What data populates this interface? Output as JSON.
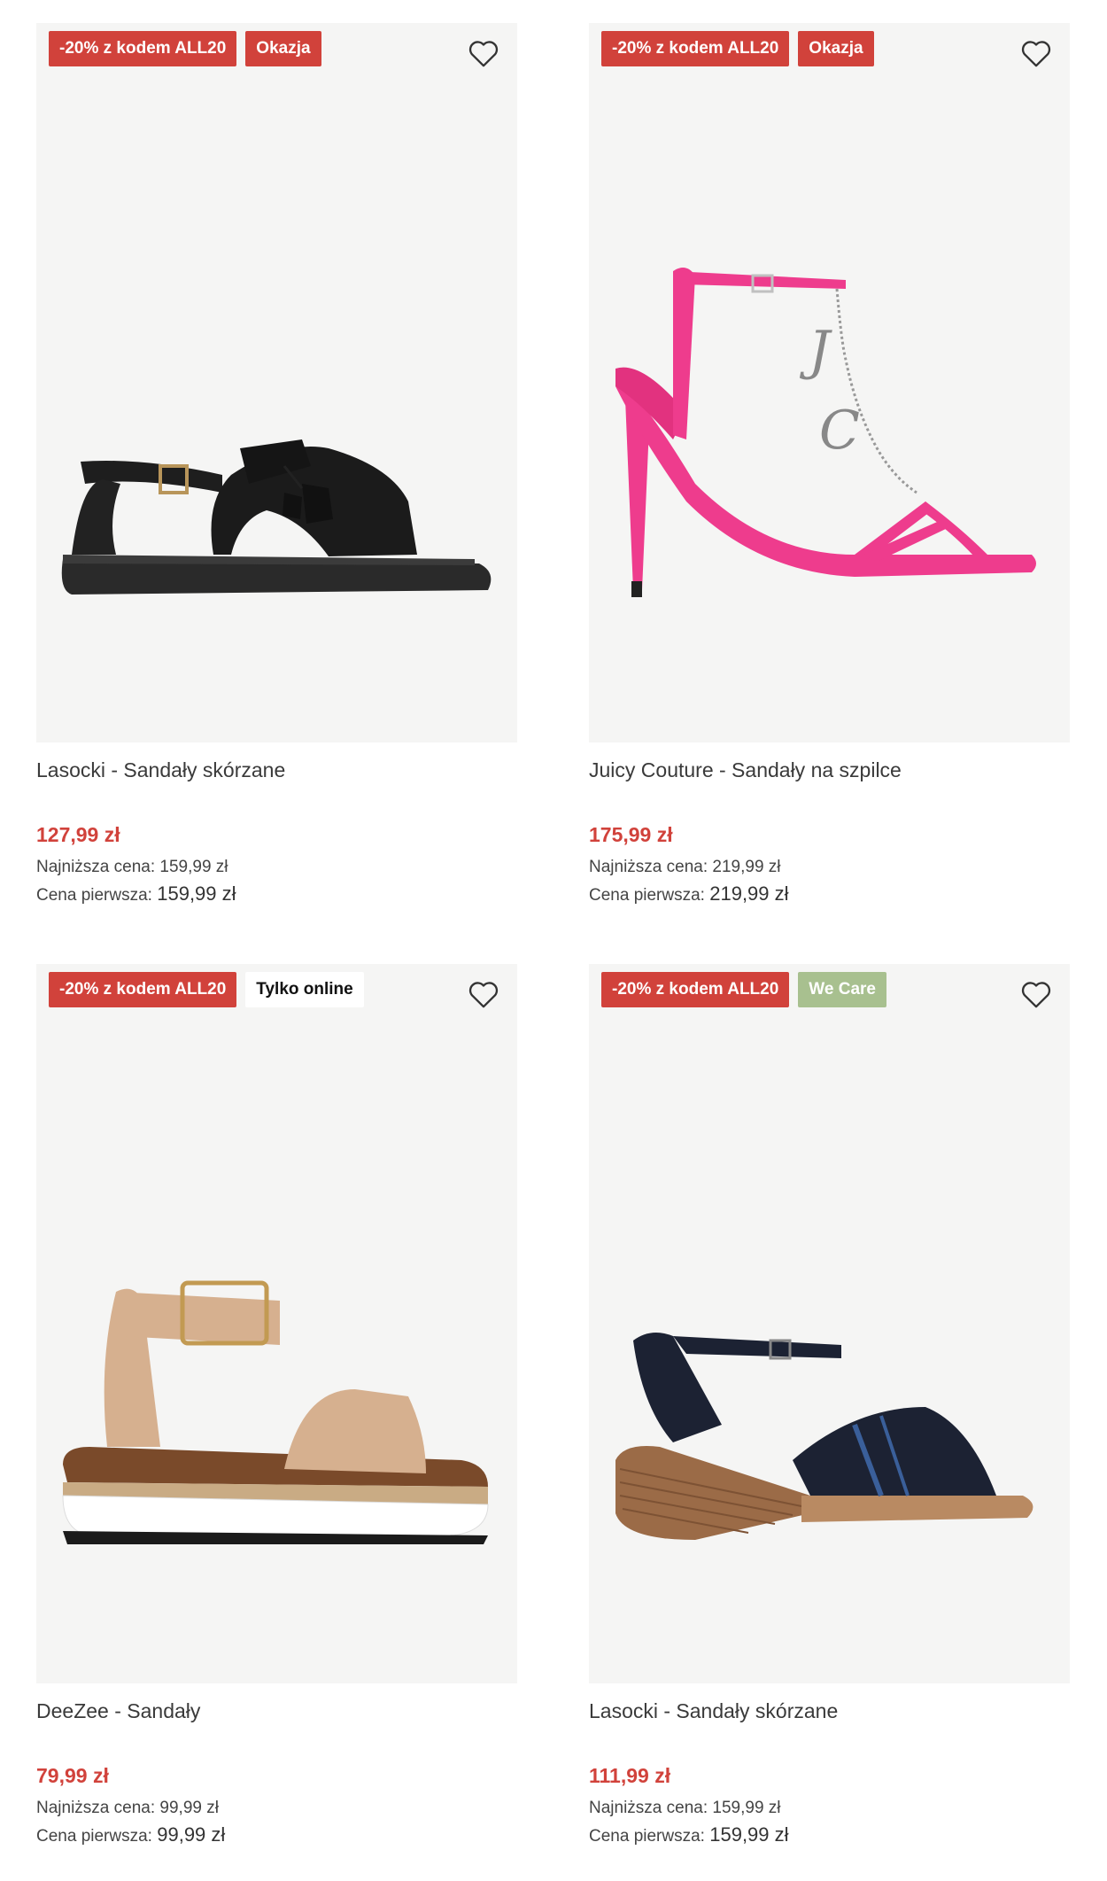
{
  "products": [
    {
      "badges": [
        {
          "text": "-20% z kodem ALL20"
        },
        {
          "text": "Okazja"
        }
      ],
      "name": "Lasocki - Sandały skórzane",
      "price": "127,99 zł",
      "lowest_label": "Najniższa cena:",
      "lowest_value": "159,99 zł",
      "first_label": "Cena pierwsza:",
      "first_value": "159,99 zł",
      "image": "black-flat-tassel-sandal"
    },
    {
      "badges": [
        {
          "text": "-20% z kodem ALL20"
        },
        {
          "text": "Okazja"
        }
      ],
      "name": "Juicy Couture - Sandały na szpilce",
      "price": "175,99 zł",
      "lowest_label": "Najniższa cena:",
      "lowest_value": "219,99 zł",
      "first_label": "Cena pierwsza:",
      "first_value": "219,99 zł",
      "image": "pink-stiletto-sandal"
    },
    {
      "badges": [
        {
          "text": "-20% z kodem ALL20"
        },
        {
          "text": "Tylko online"
        }
      ],
      "name": "DeeZee - Sandały",
      "price": "79,99 zł",
      "lowest_label": "Najniższa cena:",
      "lowest_value": "99,99 zł",
      "first_label": "Cena pierwsza:",
      "first_value": "99,99 zł",
      "image": "beige-espadrille-platform-sandal"
    },
    {
      "badges": [
        {
          "text": "-20% z kodem ALL20"
        },
        {
          "text": "We Care"
        }
      ],
      "name": "Lasocki - Sandały skórzane",
      "price": "111,99 zł",
      "lowest_label": "Najniższa cena:",
      "lowest_value": "159,99 zł",
      "first_label": "Cena pierwsza:",
      "first_value": "159,99 zł",
      "image": "navy-wedge-sandal"
    }
  ],
  "colors": {
    "accent_red": "#d1423b",
    "we_care_green": "#a8c08f",
    "image_bg": "#f5f5f4"
  },
  "icons": {
    "wishlist": "heart-outline-icon"
  }
}
